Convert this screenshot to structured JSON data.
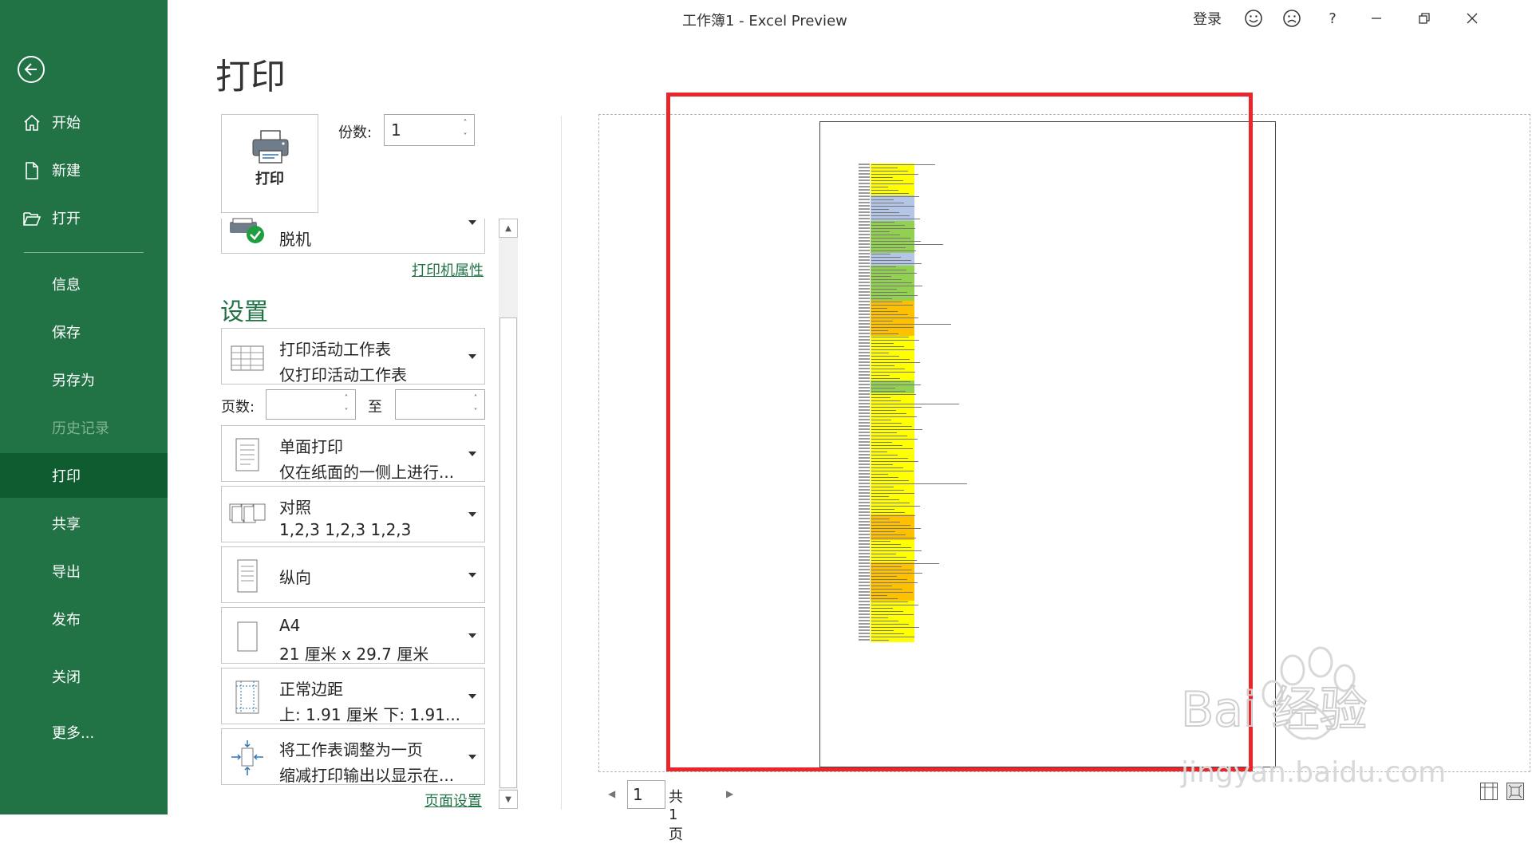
{
  "window": {
    "title": "工作簿1  -  Excel Preview",
    "login": "登录",
    "help": "?"
  },
  "sidebar": {
    "items": [
      {
        "label": "开始",
        "icon": "home-icon"
      },
      {
        "label": "新建",
        "icon": "new-file-icon"
      },
      {
        "label": "打开",
        "icon": "open-folder-icon"
      },
      {
        "label": "信息"
      },
      {
        "label": "保存"
      },
      {
        "label": "另存为"
      },
      {
        "label": "历史记录",
        "disabled": true
      },
      {
        "label": "打印",
        "active": true
      },
      {
        "label": "共享"
      },
      {
        "label": "导出"
      },
      {
        "label": "发布"
      },
      {
        "label": "关闭"
      },
      {
        "label": "更多..."
      }
    ],
    "accent": "#217346"
  },
  "print": {
    "title": "打印",
    "print_button": "打印",
    "copies_label": "份数:",
    "copies_value": "1",
    "printer_name": "脱机",
    "printer_properties": "打印机属性",
    "settings_title": "设置",
    "options": [
      {
        "line1": "打印活动工作表",
        "line2": "仅打印活动工作表"
      },
      {
        "line1": "单面打印",
        "line2": "仅在纸面的一侧上进行..."
      },
      {
        "line1": "对照",
        "line2": "1,2,3    1,2,3    1,2,3"
      },
      {
        "line1": "纵向",
        "line2": ""
      },
      {
        "line1": "A4",
        "line2": "21 厘米 x 29.7 厘米"
      },
      {
        "line1": "正常边距",
        "line2": "上: 1.91 厘米 下: 1.91..."
      },
      {
        "line1": "将工作表调整为一页",
        "line2": "缩减打印输出以显示在..."
      }
    ],
    "pages_label": "页数:",
    "pages_to": "至",
    "page_setup_link": "页面设置"
  },
  "preview": {
    "current_page": "1",
    "total_pages": "共 1 页",
    "highlight_color": "#e8262c"
  },
  "watermark": {
    "text": "Bai经验",
    "url_text": "jingyan.baidu.com"
  }
}
